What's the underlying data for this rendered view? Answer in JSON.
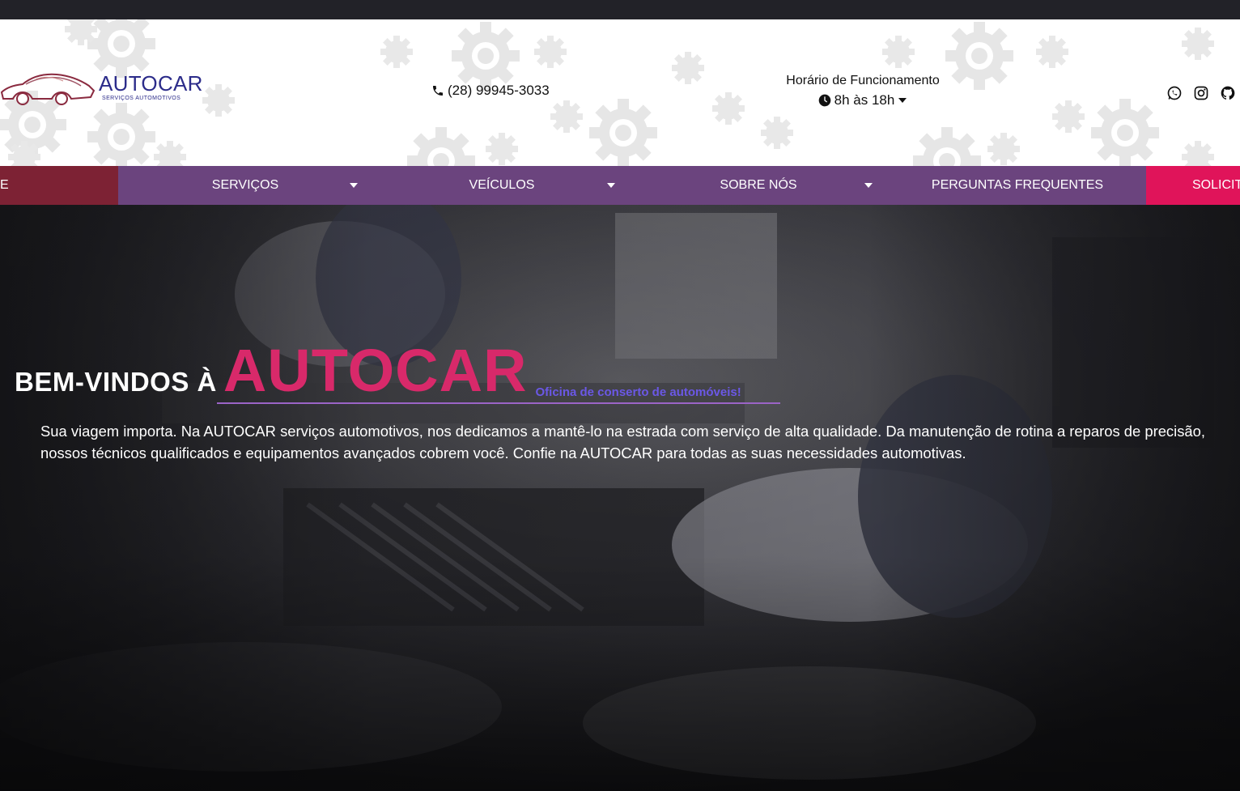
{
  "header": {
    "logo_text": "AUTOCAR",
    "logo_subtext": "SERVIÇOS AUTOMOTIVOS",
    "phone": "(28) 99945-3033",
    "hours_title": "Horário de Funcionamento",
    "hours_value": "8h às 18h",
    "socials": [
      "whatsapp-icon",
      "instagram-icon",
      "github-icon"
    ]
  },
  "nav": {
    "home_label": "E",
    "items": [
      {
        "label": "SERVIÇOS"
      },
      {
        "label": "VEÍCULOS"
      },
      {
        "label": "SOBRE NÓS"
      },
      {
        "label": "PERGUNTAS FREQUENTES"
      }
    ],
    "cta_label": "SOLICIT"
  },
  "hero": {
    "welcome": "BEM-VINDOS À",
    "brand": "AUTOCAR",
    "tagline": "Oficina de conserto de automóveis!",
    "description": "Sua viagem importa. Na AUTOCAR serviços automotivos, nos dedicamos a mantê-lo na estrada com serviço de alta qualidade. Da manutenção de rotina a reparos de precisão, nossos técnicos qualificados e equipamentos avançados cobrem você. Confie na AUTOCAR para todas as suas necessidades automotivas."
  },
  "colors": {
    "nav_bg": "#6b447e",
    "home_bg": "#7d2234",
    "cta_bg": "#e0145a",
    "brand_pink": "#d8296a",
    "tagline_blue": "#6b58e6",
    "logo_navy": "#2c2c8a"
  }
}
